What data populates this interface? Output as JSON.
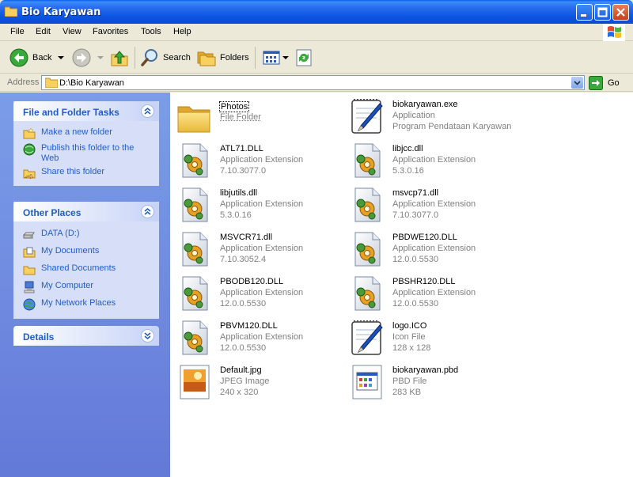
{
  "window": {
    "title": "Bio Karyawan"
  },
  "menu": [
    "File",
    "Edit",
    "View",
    "Favorites",
    "Tools",
    "Help"
  ],
  "toolbar": {
    "back": "Back",
    "search": "Search",
    "folders": "Folders"
  },
  "address": {
    "label": "Address",
    "path": "D:\\Bio Karyawan",
    "go": "Go"
  },
  "left": {
    "file_tasks": {
      "title": "File and Folder Tasks",
      "items": [
        "Make a new folder",
        "Publish this folder to the Web",
        "Share this folder"
      ]
    },
    "other_places": {
      "title": "Other Places",
      "items": [
        "DATA (D:)",
        "My Documents",
        "Shared Documents",
        "My Computer",
        "My Network Places"
      ]
    },
    "details": {
      "title": "Details"
    }
  },
  "files": [
    {
      "name": "Photos",
      "type": "File Folder",
      "desc": "",
      "icon": "folder-icon"
    },
    {
      "name": "biokaryawan.exe",
      "type": "Application",
      "desc": "Program Pendataan Karyawan",
      "icon": "exe-pen-icon"
    },
    {
      "name": "ATL71.DLL",
      "type": "Application Extension",
      "desc": "7.10.3077.0",
      "icon": "dll-icon"
    },
    {
      "name": "libjcc.dll",
      "type": "Application Extension",
      "desc": "5.3.0.16",
      "icon": "dll-icon"
    },
    {
      "name": "libjutils.dll",
      "type": "Application Extension",
      "desc": "5.3.0.16",
      "icon": "dll-icon"
    },
    {
      "name": "msvcp71.dll",
      "type": "Application Extension",
      "desc": "7.10.3077.0",
      "icon": "dll-icon"
    },
    {
      "name": "MSVCR71.dll",
      "type": "Application Extension",
      "desc": "7.10.3052.4",
      "icon": "dll-icon"
    },
    {
      "name": "PBDWE120.DLL",
      "type": "Application Extension",
      "desc": "12.0.0.5530",
      "icon": "dll-icon"
    },
    {
      "name": "PBODB120.DLL",
      "type": "Application Extension",
      "desc": "12.0.0.5530",
      "icon": "dll-icon"
    },
    {
      "name": "PBSHR120.DLL",
      "type": "Application Extension",
      "desc": "12.0.0.5530",
      "icon": "dll-icon"
    },
    {
      "name": "PBVM120.DLL",
      "type": "Application Extension",
      "desc": "12.0.0.5530",
      "icon": "dll-icon"
    },
    {
      "name": "logo.ICO",
      "type": "Icon File",
      "desc": "128 x 128",
      "icon": "ico-pen-icon"
    },
    {
      "name": "Default.jpg",
      "type": "JPEG Image",
      "desc": "240 x 320",
      "icon": "jpeg-image-icon"
    },
    {
      "name": "biokaryawan.pbd",
      "type": "PBD File",
      "desc": "283 KB",
      "icon": "pbd-file-icon"
    }
  ]
}
